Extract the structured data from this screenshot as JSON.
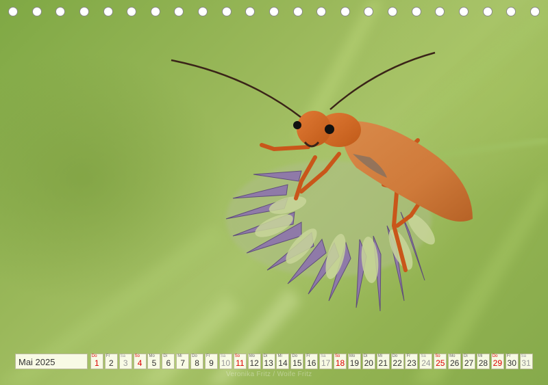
{
  "calendar": {
    "month_label": "Mai 2025",
    "days": [
      {
        "wd": "Do",
        "d": "1",
        "type": "hol"
      },
      {
        "wd": "Fr",
        "d": "2",
        "type": ""
      },
      {
        "wd": "Sa",
        "d": "3",
        "type": "we"
      },
      {
        "wd": "So",
        "d": "4",
        "type": "hol"
      },
      {
        "wd": "Mo",
        "d": "5",
        "type": ""
      },
      {
        "wd": "Di",
        "d": "6",
        "type": ""
      },
      {
        "wd": "Mi",
        "d": "7",
        "type": ""
      },
      {
        "wd": "Do",
        "d": "8",
        "type": ""
      },
      {
        "wd": "Fr",
        "d": "9",
        "type": ""
      },
      {
        "wd": "Sa",
        "d": "10",
        "type": "we"
      },
      {
        "wd": "So",
        "d": "11",
        "type": "hol"
      },
      {
        "wd": "Mo",
        "d": "12",
        "type": ""
      },
      {
        "wd": "Di",
        "d": "13",
        "type": ""
      },
      {
        "wd": "Mi",
        "d": "14",
        "type": ""
      },
      {
        "wd": "Do",
        "d": "15",
        "type": ""
      },
      {
        "wd": "Fr",
        "d": "16",
        "type": ""
      },
      {
        "wd": "Sa",
        "d": "17",
        "type": "we"
      },
      {
        "wd": "So",
        "d": "18",
        "type": "hol"
      },
      {
        "wd": "Mo",
        "d": "19",
        "type": ""
      },
      {
        "wd": "Di",
        "d": "20",
        "type": ""
      },
      {
        "wd": "Mi",
        "d": "21",
        "type": ""
      },
      {
        "wd": "Do",
        "d": "22",
        "type": ""
      },
      {
        "wd": "Fr",
        "d": "23",
        "type": ""
      },
      {
        "wd": "Sa",
        "d": "24",
        "type": "we"
      },
      {
        "wd": "So",
        "d": "25",
        "type": "hol"
      },
      {
        "wd": "Mo",
        "d": "26",
        "type": ""
      },
      {
        "wd": "Di",
        "d": "27",
        "type": ""
      },
      {
        "wd": "Mi",
        "d": "28",
        "type": ""
      },
      {
        "wd": "Do",
        "d": "29",
        "type": "hol"
      },
      {
        "wd": "Fr",
        "d": "30",
        "type": ""
      },
      {
        "wd": "Sa",
        "d": "31",
        "type": "we"
      }
    ]
  },
  "copyright": "Veronika Fritz / Woife Fritz",
  "colors": {
    "holiday": "#dd0000",
    "beetle": "#d9661f",
    "background": "#8fb255"
  }
}
